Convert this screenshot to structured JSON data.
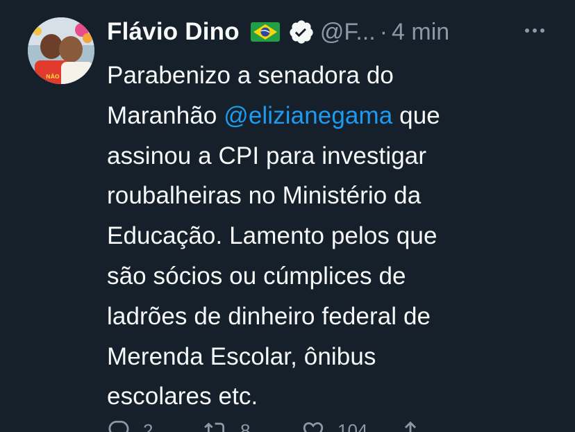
{
  "author": {
    "name": "Flávio Dino",
    "flag_icon": "brazil-flag-icon",
    "verified_icon": "verified-badge-icon",
    "handle": "@F...",
    "separator": "·",
    "time": "4 min"
  },
  "more_icon": "more-horizontal-icon",
  "tweet": {
    "lines": [
      [
        {
          "text": "Parabenizo a senadora do"
        }
      ],
      [
        {
          "text": "Maranhão "
        },
        {
          "text": "@elizianegama",
          "mention": true
        },
        {
          "text": " que"
        }
      ],
      [
        {
          "text": "assinou a CPI para investigar"
        }
      ],
      [
        {
          "text": "roubalheiras no Ministério da"
        }
      ],
      [
        {
          "text": "Educação. Lamento pelos que"
        }
      ],
      [
        {
          "text": "são sócios ou cúmplices de"
        }
      ],
      [
        {
          "text": "ladrões de dinheiro federal de"
        }
      ],
      [
        {
          "text": "Merenda Escolar, ônibus"
        }
      ],
      [
        {
          "text": "escolares etc."
        }
      ]
    ]
  },
  "actions": {
    "reply": {
      "icon": "reply-icon",
      "count": "2"
    },
    "retweet": {
      "icon": "retweet-icon",
      "count": "8"
    },
    "like": {
      "icon": "heart-icon",
      "count": "104"
    },
    "share": {
      "icon": "share-icon"
    }
  },
  "colors": {
    "background": "#15202b",
    "text": "#f7f9f9",
    "muted": "#8b98a5",
    "accent": "#1d9bf0"
  }
}
